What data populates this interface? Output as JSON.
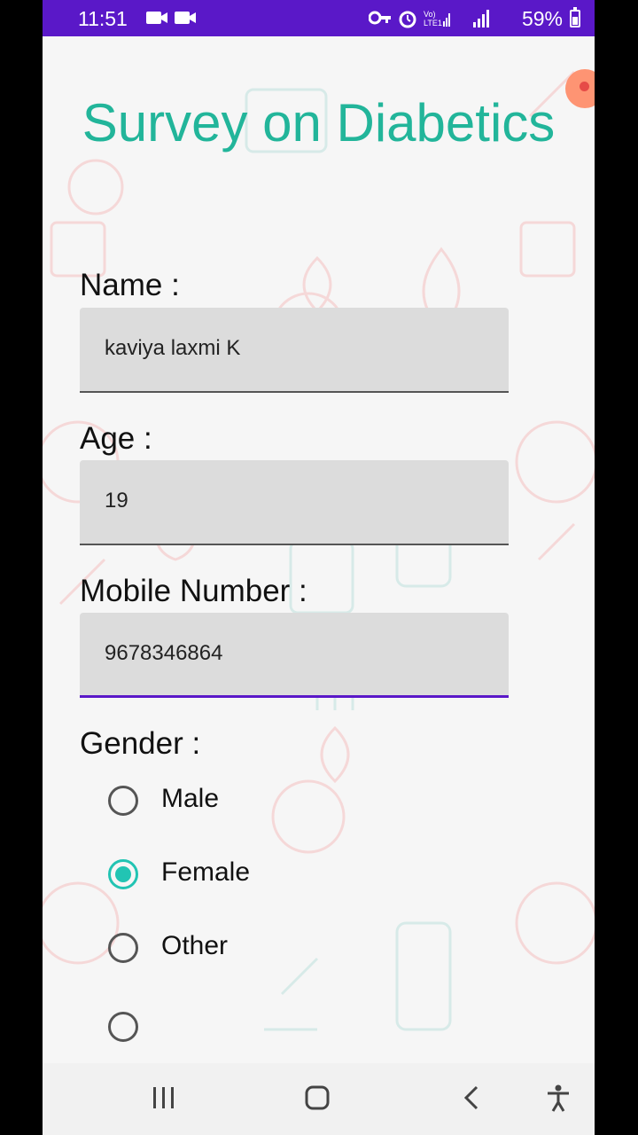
{
  "status_bar": {
    "time": "11:51",
    "left_icons": [
      "video-camera-icon",
      "video-camera-icon"
    ],
    "right_icons": [
      "key-icon",
      "alarm-icon",
      "volte-signal-icon",
      "signal-icon"
    ],
    "volte_label": "Vo) LTE1",
    "battery": "59%",
    "battery_level": 0.59
  },
  "form": {
    "title": "Survey on Diabetics",
    "name_label": "Name :",
    "name_value": "kaviya laxmi K",
    "age_label": "Age :",
    "age_value": "19",
    "mobile_label": "Mobile Number :",
    "mobile_value": "9678346864",
    "gender_label": "Gender :",
    "gender_options": [
      "Male",
      "Female",
      "Other"
    ],
    "gender_selected": "Female"
  },
  "navigation": {
    "icons": [
      "recent-apps-icon",
      "home-icon",
      "back-icon",
      "accessibility-icon"
    ]
  },
  "colors": {
    "status_bar": "#5a18c8",
    "title": "#22b59a",
    "radio_checked": "#22c4b3",
    "focus_underline": "#5a18c8"
  }
}
